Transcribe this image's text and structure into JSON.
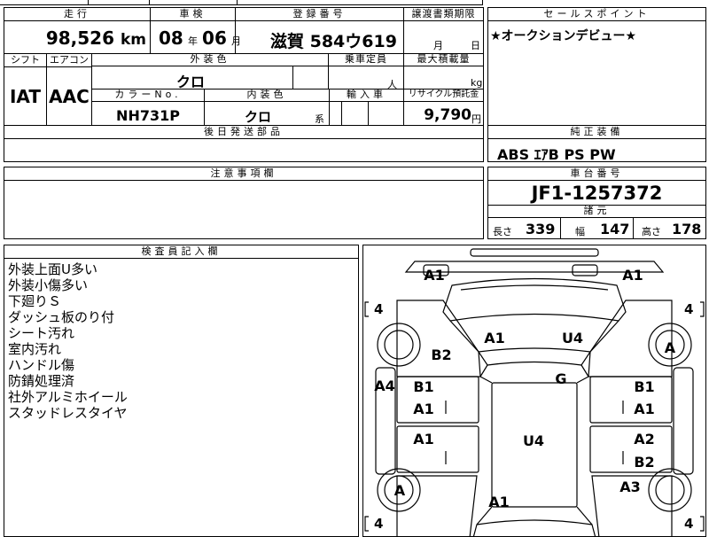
{
  "top_strip": [
    "",
    "",
    "",
    ""
  ],
  "row1": {
    "mileage_header": "走行",
    "mileage_value": "98,526",
    "mileage_unit": "km",
    "inspection_header": "車検",
    "inspection_year": "08",
    "inspection_year_unit": "年",
    "inspection_month": "06",
    "inspection_month_unit": "月",
    "plate_header": "登録番号",
    "plate_value": "滋賀 584ウ619",
    "transfer_header": "譲渡書類期限",
    "transfer_month": "月",
    "transfer_day": "日"
  },
  "row2": {
    "shift_header": "シフト",
    "ac_header": "エアコン",
    "exterior_header": "外装色",
    "exterior_value": "クロ",
    "capacity_header": "乗車定員",
    "capacity_unit": "人",
    "maxload_header": "最大積載量",
    "maxload_unit": "kg",
    "shift_value": "IAT",
    "ac_value": "AAC",
    "colorno_header": "カラーNo.",
    "colorno_value": "NH731P",
    "interior_header": "内装色",
    "interior_value": "クロ",
    "interior_suffix": "系",
    "import_header": "輸入車",
    "recycle_header": "リサイクル預託金",
    "recycle_value": "9,790",
    "recycle_unit": "円"
  },
  "later_parts": {
    "header": "後日発送部品",
    "value": ""
  },
  "notes": {
    "header": "注意事項欄",
    "value": ""
  },
  "sales_point": {
    "header": "セールスポイント",
    "value": "★オークションデビュー★"
  },
  "equipment": {
    "header": "純正装備",
    "value": "ABS ｴｱB PS PW"
  },
  "chassis": {
    "header": "車台番号",
    "value": "JF1-1257372"
  },
  "dimensions": {
    "header": "諸元",
    "length_label": "長さ",
    "length_value": "339",
    "width_label": "幅",
    "width_value": "147",
    "height_label": "高さ",
    "height_value": "178"
  },
  "inspector": {
    "header": "検査員記入欄",
    "lines": [
      "外装上面U多い",
      "外装小傷多い",
      "下廻りＳ",
      "ダッシュ板のり付",
      "シート汚れ",
      "室内汚れ",
      "ハンドル傷",
      "防錆処理済",
      "社外アルミホイール",
      "スタッドレスタイヤ"
    ]
  },
  "diagram": {
    "front_left": "A1",
    "front_right": "A1",
    "bonnet_left": "A1",
    "bonnet_right": "U4",
    "fender_front_left": "B2",
    "roof": "G",
    "side_left": "A4",
    "front_door_left_1": "B1",
    "front_door_left_2": "A1",
    "front_door_right_1": "B1",
    "front_door_right_2": "A1",
    "rear_door_left": "A1",
    "rear_door_right_1": "A2",
    "rear_door_right_2": "B2",
    "floor_center": "U4",
    "wheel_front_right": "A",
    "wheel_rear_left": "A",
    "rear_fender_right": "A3",
    "rear_center": "A1",
    "tire_tl": "4",
    "tire_tr": "4",
    "tire_bl": "4",
    "tire_br": "4",
    "bracket_open": "[",
    "bracket_close": "]"
  }
}
